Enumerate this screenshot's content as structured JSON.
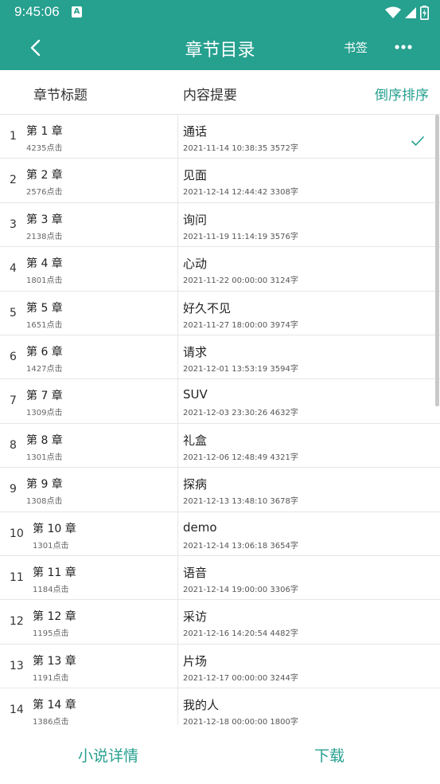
{
  "status_bar": {
    "time": "9:45:06",
    "notif_badge": "A"
  },
  "app_bar": {
    "title": "章节目录",
    "bookmark_label": "书签"
  },
  "header": {
    "col_title": "章节标题",
    "col_summary": "内容提要",
    "sort_label": "倒序排序"
  },
  "chapters": [
    {
      "index": "1",
      "chapter": "第 1 章",
      "clicks": "4235点击",
      "name": "通话",
      "datetime": "2021-11-14 10:38:35",
      "words": "3572字",
      "checked": true
    },
    {
      "index": "2",
      "chapter": "第 2 章",
      "clicks": "2576点击",
      "name": "见面",
      "datetime": "2021-12-14 12:44:42",
      "words": "3308字"
    },
    {
      "index": "3",
      "chapter": "第 3 章",
      "clicks": "2138点击",
      "name": "询问",
      "datetime": "2021-11-19 11:14:19",
      "words": "3576字"
    },
    {
      "index": "4",
      "chapter": "第 4 章",
      "clicks": "1801点击",
      "name": "心动",
      "datetime": "2021-11-22 00:00:00",
      "words": "3124字"
    },
    {
      "index": "5",
      "chapter": "第 5 章",
      "clicks": "1651点击",
      "name": "好久不见",
      "datetime": "2021-11-27 18:00:00",
      "words": "3974字"
    },
    {
      "index": "6",
      "chapter": "第 6 章",
      "clicks": "1427点击",
      "name": "请求",
      "datetime": "2021-12-01 13:53:19",
      "words": "3594字"
    },
    {
      "index": "7",
      "chapter": "第 7 章",
      "clicks": "1309点击",
      "name": "SUV",
      "datetime": "2021-12-03 23:30:26",
      "words": "4632字"
    },
    {
      "index": "8",
      "chapter": "第 8 章",
      "clicks": "1301点击",
      "name": "礼盒",
      "datetime": "2021-12-06 12:48:49",
      "words": "4321字"
    },
    {
      "index": "9",
      "chapter": "第 9 章",
      "clicks": "1308点击",
      "name": "探病",
      "datetime": "2021-12-13 13:48:10",
      "words": "3678字"
    },
    {
      "index": "10",
      "chapter": "第 10 章",
      "clicks": "1301点击",
      "name": "demo",
      "datetime": "2021-12-14 13:06:18",
      "words": "3654字"
    },
    {
      "index": "11",
      "chapter": "第 11 章",
      "clicks": "1184点击",
      "name": "语音",
      "datetime": "2021-12-14 19:00:00",
      "words": "3306字"
    },
    {
      "index": "12",
      "chapter": "第 12 章",
      "clicks": "1195点击",
      "name": "采访",
      "datetime": "2021-12-16 14:20:54",
      "words": "4482字"
    },
    {
      "index": "13",
      "chapter": "第 13 章",
      "clicks": "1191点击",
      "name": "片场",
      "datetime": "2021-12-17 00:00:00",
      "words": "3244字"
    },
    {
      "index": "14",
      "chapter": "第 14 章",
      "clicks": "1386点击",
      "name": "我的人",
      "datetime": "2021-12-18 00:00:00",
      "words": "1800字"
    }
  ],
  "bottom_bar": {
    "detail_label": "小说详情",
    "download_label": "下载"
  },
  "colors": {
    "primary": "#26A08F",
    "divider": "#E6E6E6",
    "scrollbar": "#C9C9C9"
  },
  "icons": [
    "back-arrow-icon",
    "more-dots-icon",
    "wifi-icon",
    "signal-icon",
    "battery-charging-icon",
    "check-icon"
  ]
}
